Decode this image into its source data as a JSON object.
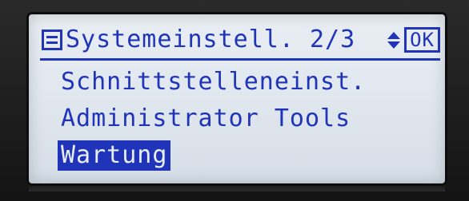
{
  "header": {
    "title": "Systemeinstell. 2/3",
    "ok_label": "OK",
    "menu_icon": "menu-list-icon",
    "scroll_icon": "up-down-arrows-icon"
  },
  "menu": {
    "items": [
      {
        "label": "Schnittstelleneinst.",
        "selected": false
      },
      {
        "label": "Administrator Tools",
        "selected": false
      },
      {
        "label": "Wartung",
        "selected": true
      }
    ]
  },
  "colors": {
    "lcd_background": "#e9eef3",
    "lcd_text": "#1f34b8"
  }
}
